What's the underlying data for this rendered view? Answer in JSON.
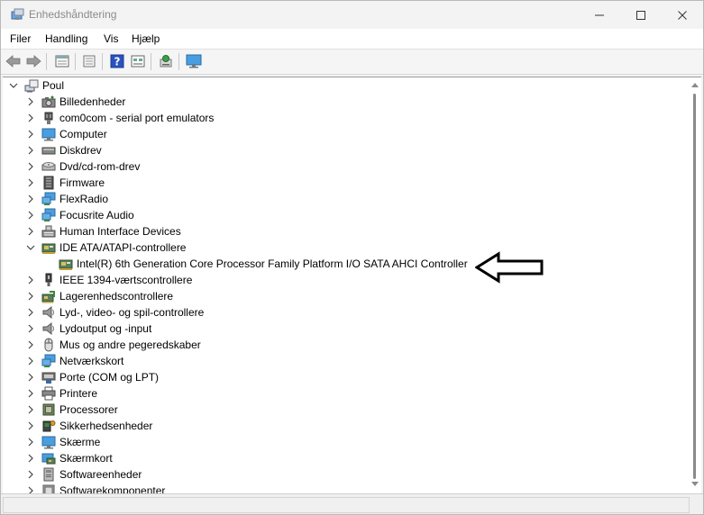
{
  "window": {
    "title": "Enhedshåndtering"
  },
  "menu": {
    "items": [
      "Filer",
      "Handling",
      "Vis",
      "Hjælp"
    ]
  },
  "toolbar": {
    "buttons": [
      "back-icon",
      "forward-icon",
      "properties-icon",
      "update-icon",
      "help-icon",
      "view-icon",
      "scan-icon",
      "monitor-icon"
    ]
  },
  "tree": {
    "root": "Poul",
    "items": [
      {
        "label": "Billedenheder",
        "icon": "camera-icon",
        "expanded": false
      },
      {
        "label": "com0com - serial port emulators",
        "icon": "serial-icon",
        "expanded": false
      },
      {
        "label": "Computer",
        "icon": "computer-icon",
        "expanded": false
      },
      {
        "label": "Diskdrev",
        "icon": "disk-icon",
        "expanded": false
      },
      {
        "label": "Dvd/cd-rom-drev",
        "icon": "dvd-icon",
        "expanded": false
      },
      {
        "label": "Firmware",
        "icon": "firmware-icon",
        "expanded": false
      },
      {
        "label": "FlexRadio",
        "icon": "network-icon",
        "expanded": false
      },
      {
        "label": "Focusrite Audio",
        "icon": "network-icon",
        "expanded": false
      },
      {
        "label": "Human Interface Devices",
        "icon": "hid-icon",
        "expanded": false
      },
      {
        "label": "IDE ATA/ATAPI-controllere",
        "icon": "controller-icon",
        "expanded": true
      },
      {
        "label": "Intel(R) 6th Generation Core Processor Family Platform I/O SATA AHCI Controller",
        "icon": "controller-icon",
        "child": true
      },
      {
        "label": "IEEE 1394-værtscontrollere",
        "icon": "firewire-icon",
        "expanded": false
      },
      {
        "label": "Lagerenhedscontrollere",
        "icon": "storage-controller-icon",
        "expanded": false
      },
      {
        "label": "Lyd-, video- og spil-controllere",
        "icon": "speaker-icon",
        "expanded": false
      },
      {
        "label": "Lydoutput og -input",
        "icon": "speaker-icon",
        "expanded": false
      },
      {
        "label": "Mus og andre pegeredskaber",
        "icon": "mouse-icon",
        "expanded": false
      },
      {
        "label": "Netværkskort",
        "icon": "network-icon",
        "expanded": false
      },
      {
        "label": "Porte (COM og LPT)",
        "icon": "port-icon",
        "expanded": false
      },
      {
        "label": "Printere",
        "icon": "printer-icon",
        "expanded": false
      },
      {
        "label": "Processorer",
        "icon": "processor-icon",
        "expanded": false
      },
      {
        "label": "Sikkerhedsenheder",
        "icon": "security-icon",
        "expanded": false
      },
      {
        "label": "Skærme",
        "icon": "monitor-icon",
        "expanded": false
      },
      {
        "label": "Skærmkort",
        "icon": "display-adapter-icon",
        "expanded": false
      },
      {
        "label": "Softwareenheder",
        "icon": "software-icon",
        "expanded": false
      },
      {
        "label": "Softwarekomponenter",
        "icon": "software-component-icon",
        "expanded": false
      }
    ]
  },
  "colors": {
    "accent_blue": "#1e6fd9",
    "annotation": "#000000"
  }
}
